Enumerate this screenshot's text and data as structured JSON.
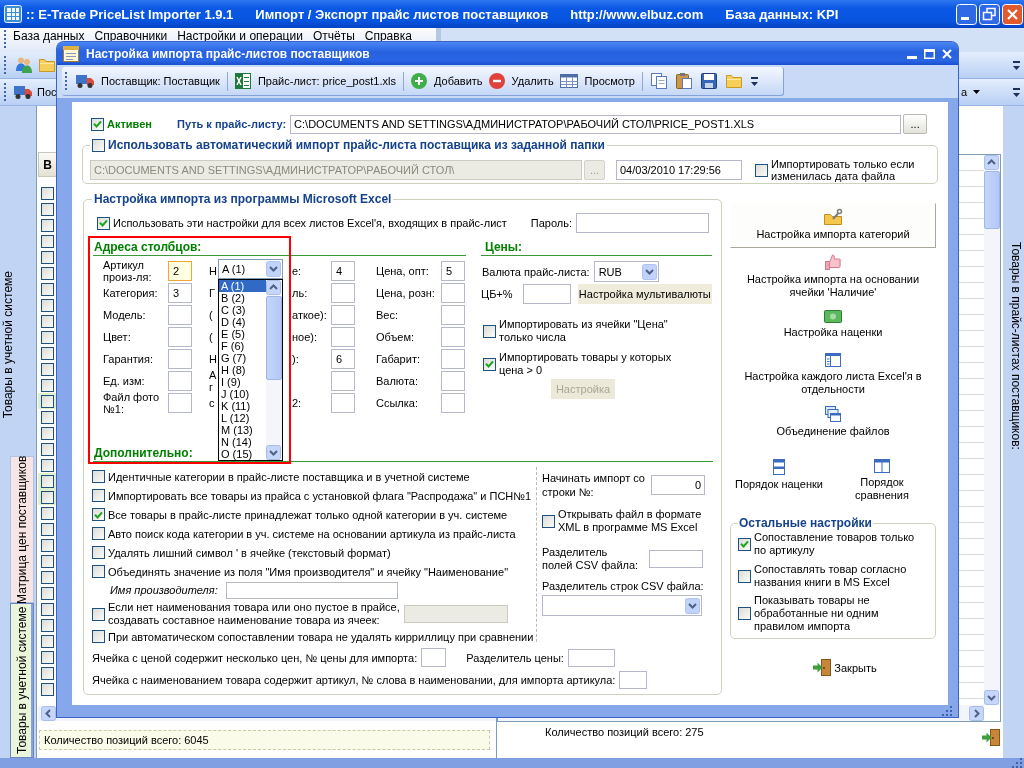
{
  "main_window": {
    "title_parts": [
      ":: E-Trade PriceList Importer 1.9.1",
      "Импорт / Экспорт прайс листов поставщиков",
      "http://www.elbuz.com",
      "База данных: KPI"
    ],
    "menu": [
      "База данных",
      "Справочники",
      "Настройки и операции",
      "Отчёты",
      "Справка"
    ],
    "toolbar_2": {
      "left_label": "Пос",
      "right_label": "а"
    },
    "left_dock": {
      "caption": "Товары в учетной системе",
      "tabs": [
        {
          "label": "Матрица цен поставщиков",
          "selected": false,
          "color": "#f7e4e4"
        },
        {
          "label": "Товары в учетной системе",
          "selected": true,
          "color": "#ebf5da"
        }
      ]
    },
    "left_grid": {
      "header": "В",
      "rows": [
        {
          "checked": false,
          "selected": false
        },
        {
          "checked": false,
          "selected": false
        },
        {
          "checked": false,
          "selected": false
        },
        {
          "checked": false,
          "selected": false
        },
        {
          "checked": false,
          "selected": false
        },
        {
          "checked": false,
          "selected": false
        },
        {
          "checked": false,
          "selected": false
        },
        {
          "checked": false,
          "selected": false
        },
        {
          "checked": false,
          "selected": false
        },
        {
          "checked": false,
          "selected": false
        },
        {
          "checked": false,
          "selected": false
        },
        {
          "checked": false,
          "selected": false
        },
        {
          "checked": false,
          "selected": false
        },
        {
          "checked": false,
          "selected": true
        },
        {
          "checked": false,
          "selected": false
        },
        {
          "checked": false,
          "selected": false
        },
        {
          "checked": false,
          "selected": false
        },
        {
          "checked": false,
          "selected": false
        },
        {
          "checked": false,
          "selected": true
        },
        {
          "checked": false,
          "selected": true
        },
        {
          "checked": false,
          "selected": false
        },
        {
          "checked": false,
          "selected": false
        },
        {
          "checked": false,
          "selected": false
        },
        {
          "checked": false,
          "selected": false
        },
        {
          "checked": false,
          "selected": false
        },
        {
          "checked": false,
          "selected": false
        },
        {
          "checked": false,
          "selected": false
        },
        {
          "checked": false,
          "selected": false
        },
        {
          "checked": false,
          "selected": false
        },
        {
          "checked": false,
          "selected": false
        },
        {
          "checked": false,
          "selected": false
        },
        {
          "checked": false,
          "selected": false
        }
      ]
    },
    "left_status": "Количество позиций всего: 6045",
    "right_status": "Количество позиций всего: 275",
    "right_caption": "Товары в прайс-листах поставщиков:"
  },
  "dialog": {
    "title": "Настройка импорта прайс-листов поставщиков",
    "toolbar": [
      "Поставщик: Поставщик",
      "Прайс-лист: price_post1.xls",
      "Добавить",
      "Удалить",
      "Просмотр"
    ],
    "active": {
      "label": "Активен",
      "checked": true
    },
    "path": {
      "label": "Путь к прайс-листу:",
      "value": "C:\\DOCUMENTS AND SETTINGS\\АДМИНИСТРАТОР\\РАБОЧИЙ СТОЛ\\PRICE_POST1.XLS",
      "browse": "..."
    },
    "auto_import": {
      "label": "Использовать автоматический импорт прайс-листа поставщика из заданной папки",
      "checked": false,
      "folder": {
        "value": "C:\\DOCUMENTS AND SETTINGS\\АДМИНИСТРАТОР\\РАБОЧИЙ СТОЛ\\",
        "disabled": true
      },
      "browse": {
        "label": "...",
        "disabled": true
      },
      "date": "04/03/2010 17:29:56",
      "only_changed": {
        "label": "Импортировать только если изменилась дата файла",
        "checked": false
      }
    },
    "excel": {
      "title": "Настройка импорта из программы Microsoft Excel",
      "all_sheets": {
        "label": "Использовать эти настройки для всех листов Excel'я, входящих в прайс-лист",
        "checked": true
      },
      "password_label": "Пароль:",
      "addresses": {
        "title": "Адреса столбцов:",
        "fields": [
          [
            {
              "label": "Артикул произ-ля:",
              "value": "2",
              "focused": true
            },
            {
              "label": "Категория:",
              "value": "3",
              "focused": false
            },
            {
              "label": "Модель:",
              "focused": false
            },
            {
              "label": "Цвет:",
              "focused": false
            },
            {
              "label": "Гарантия:",
              "focused": false
            },
            {
              "label": "Ед. изм:",
              "focused": false
            },
            {
              "label": "Файл фото №1:",
              "focused": false
            }
          ],
          [
            {
              "label_start": "Н",
              "label_end": "е:",
              "value": "4",
              "focused": false
            },
            {
              "label_start": "Г",
              "label_end": "ль:",
              "focused": false
            },
            {
              "label_start": "(",
              "label_end": "аткое):",
              "focused": false
            },
            {
              "label_start": "(",
              "label_end": "ное):",
              "focused": false
            },
            {
              "label_start": "Н",
              "label_end": "):",
              "value": "6",
              "focused": false
            },
            {
              "label_start": "А г",
              "focused": false
            },
            {
              "label_start": "с",
              "label_end": "2:",
              "focused": false
            }
          ],
          [
            {
              "label": "Цена, опт:",
              "value": "5",
              "focused": false
            },
            {
              "label": "Цена, розн:",
              "focused": false
            },
            {
              "label": "Вес:",
              "focused": false
            },
            {
              "label": "Объем:",
              "focused": false
            },
            {
              "label": "Габарит:",
              "focused": false
            },
            {
              "label": "Валюта:",
              "focused": false
            },
            {
              "label": "Ссылка:",
              "focused": false
            }
          ]
        ]
      },
      "column_picker": {
        "value": "A (1)",
        "options": [
          {
            "label": "A (1)",
            "selected": true
          },
          {
            "label": "B (2)",
            "selected": false
          },
          {
            "label": "C (3)",
            "selected": false
          },
          {
            "label": "D (4)",
            "selected": false
          },
          {
            "label": "E (5)",
            "selected": false
          },
          {
            "label": "F (6)",
            "selected": false
          },
          {
            "label": "G (7)",
            "selected": false
          },
          {
            "label": "H (8)",
            "selected": false
          },
          {
            "label": "I (9)",
            "selected": false
          },
          {
            "label": "J (10)",
            "selected": false
          },
          {
            "label": "K (11)",
            "selected": false
          },
          {
            "label": "L (12)",
            "selected": false
          },
          {
            "label": "M (13)",
            "selected": false
          },
          {
            "label": "N (14)",
            "selected": false
          },
          {
            "label": "O (15)",
            "selected": false
          }
        ]
      },
      "prices": {
        "title": "Цены:",
        "currency_label": "Валюта прайс-листа:",
        "currency": "RUB",
        "cb_label": "ЦБ+%",
        "multicurrency_button": "Настройка мультивалюты",
        "numbers_only": {
          "label": "Импортировать из ячейки \"Цена\" только числа",
          "checked": false
        },
        "positive_only": {
          "label": "Импортировать товары у которых цена > 0",
          "checked": true
        },
        "setup_button": {
          "label": "Настройка",
          "disabled": true
        }
      },
      "extra": {
        "title": "Дополнительно:",
        "options": [
          {
            "kind": "checkbox",
            "label": "Идентичные категории в прайс-листе поставщика и в учетной системе",
            "checked": false
          },
          {
            "kind": "checkbox",
            "label": "Импортировать все товары из прайса с установкой флага \"Распродажа\" и ПСН№1",
            "checked": false
          },
          {
            "kind": "checkbox",
            "label": "Все товары в прайс-листе принадлежат только одной категории в уч. системе",
            "checked": true
          },
          {
            "kind": "checkbox",
            "label": "Авто поиск кода категории в уч. системе на основании артикула из прайс-листа",
            "checked": false
          },
          {
            "kind": "checkbox",
            "label": "Удалять лишний символ ' в ячейке (текстовый формат)",
            "checked": false
          },
          {
            "kind": "checkbox",
            "label": "Объединять значение из поля \"Имя производителя\" и ячейку \"Наименование\"",
            "checked": false
          },
          {
            "kind": "name_field",
            "label": "Имя производителя:"
          },
          {
            "kind": "checkbox_field",
            "label": "Если нет наименования товара или оно пустое в прайсе, создавать составное наименование товара из ячеек:",
            "checked": false,
            "field_disabled": true
          },
          {
            "kind": "checkbox",
            "label": "При автоматическом сопоставлении товара не удалять кирриллицу при сравнении",
            "checked": false
          }
        ],
        "start_row": {
          "label": "Начинать импорт со строки №:",
          "value": "0"
        },
        "xml": {
          "label": "Открывать файл в формате XML в программе MS Excel",
          "checked": false
        },
        "csv_fields_label": "Разделитель полей CSV файла:",
        "csv_rows_label": "Разделитель строк CSV файла:",
        "price_index_label": "Ячейка с ценой содержит несколько цен, № цены для импорта:",
        "price_separator_label": "Разделитель цены:",
        "article_word_label": "Ячейка с наименованием товара содержит артикул, № слова в наименовании, для импорта артикула:"
      }
    },
    "side_actions": [
      {
        "label": "Настройка импорта категорий",
        "hovered": true
      },
      {
        "label": "Настройка импорта на основании ячейки 'Наличие'",
        "hovered": false
      },
      {
        "label": "Настройка наценки",
        "hovered": false
      },
      {
        "label": "Настройка каждого листа Excel'я в отдельности",
        "hovered": false
      },
      {
        "label": "Объединение файлов",
        "hovered": false
      }
    ],
    "order_actions": [
      {
        "label": "Порядок наценки",
        "hovered": false
      },
      {
        "label": "Порядок сравнения",
        "hovered": false
      }
    ],
    "other_settings": {
      "title": "Остальные настройки",
      "options": [
        {
          "label": "Сопоставление товаров только по артикулу",
          "checked": true
        },
        {
          "label": "Сопоставлять товар согласно названия книги в MS Excel",
          "checked": false
        },
        {
          "label": "Показывать товары не обработанные ни одним правилом импорта",
          "checked": false
        }
      ]
    },
    "close_label": "Закрыть"
  }
}
